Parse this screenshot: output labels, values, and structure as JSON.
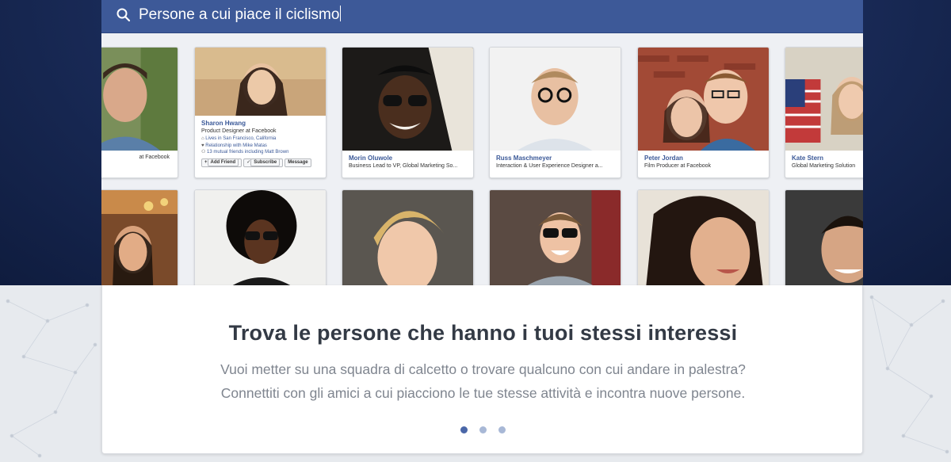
{
  "search": {
    "query": "Persone a cui piace il ciclismo",
    "icon": "search-icon"
  },
  "colors": {
    "brand": "#3d5998",
    "navy_background": "#1b2d5c",
    "link": "#3b5998",
    "dot_active": "#4a67a8",
    "dot_inactive": "#a8b8d6"
  },
  "cards_row1": [
    {
      "name": "",
      "job": "at Facebook"
    },
    {
      "name": "Sharon Hwang",
      "job": "Product Designer at Facebook",
      "lives": "Lives in San Francisco, California",
      "relationship": "Relationship with Mike Matas",
      "mutual": "13 mutual friends including Matt Brown",
      "add_friend": "Add Friend",
      "subscribe": "Subscribe",
      "message": "Message"
    },
    {
      "name": "Morin Oluwole",
      "job": "Business Lead to VP, Global Marketing So..."
    },
    {
      "name": "Russ Maschmeyer",
      "job": "Interaction & User Experience Designer a..."
    },
    {
      "name": "Peter Jordan",
      "job": "Film Producer at Facebook"
    },
    {
      "name": "Kate Stern",
      "job": "Global Marketing Solution"
    }
  ],
  "panel": {
    "title": "Trova le persone che hanno i tuoi stessi interessi",
    "line1": "Vuoi metter su una squadra di calcetto o trovare qualcuno con cui andare in palestra?",
    "line2": "Connettiti con gli amici a cui piacciono le tue stesse attività e incontra nuove persone."
  },
  "pagination": {
    "pages": 3,
    "active": 1
  }
}
